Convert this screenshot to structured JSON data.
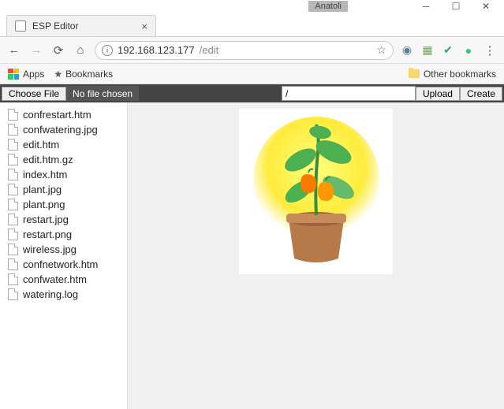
{
  "window": {
    "user_badge": "Anatoli"
  },
  "tab": {
    "title": "ESP Editor"
  },
  "nav": {
    "url_host": "192.168.123.177",
    "url_path": "/edit"
  },
  "bookmarks": {
    "apps_label": "Apps",
    "bookmarks_label": "Bookmarks",
    "other_label": "Other bookmarks"
  },
  "editor_toolbar": {
    "choose_file": "Choose File",
    "file_status": "No file chosen",
    "path_value": "/",
    "upload": "Upload",
    "create": "Create"
  },
  "files": [
    "confrestart.htm",
    "confwatering.jpg",
    "edit.htm",
    "edit.htm.gz",
    "index.htm",
    "plant.jpg",
    "plant.png",
    "restart.jpg",
    "restart.png",
    "wireless.jpg",
    "confnetwork.htm",
    "confwater.htm",
    "watering.log"
  ],
  "preview": {
    "alt": "plant in pot"
  }
}
